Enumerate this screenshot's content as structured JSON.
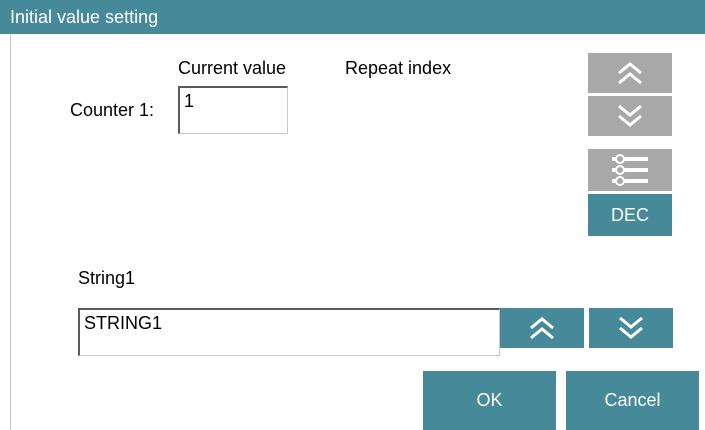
{
  "window": {
    "title": "Initial value setting"
  },
  "counter_section": {
    "current_value_header": "Current value",
    "repeat_index_header": "Repeat index",
    "counter1_label": "Counter 1:",
    "counter1_value": "1"
  },
  "side_buttons": {
    "up_icon": "double-chevron-up-icon",
    "down_icon": "double-chevron-down-icon",
    "settings_icon": "sliders-icon",
    "dec_label": "DEC"
  },
  "string_section": {
    "label": "String1",
    "value": "STRING1",
    "up_icon": "double-chevron-up-icon",
    "down_icon": "double-chevron-down-icon"
  },
  "footer": {
    "ok_label": "OK",
    "cancel_label": "Cancel"
  },
  "colors": {
    "accent": "#468a99",
    "disabled_button": "#a8a8a8"
  }
}
